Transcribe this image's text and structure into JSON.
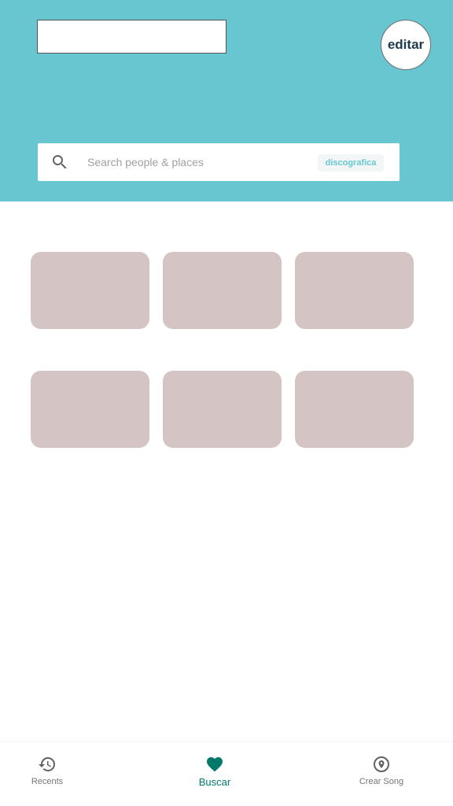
{
  "header": {
    "edit_label": "editar",
    "colors": {
      "background": "#67c6cf",
      "button_text": "#1f3a4a"
    }
  },
  "search": {
    "placeholder": "Search people & places",
    "value": "",
    "chip_label": "discografica"
  },
  "tiles": {
    "count": 6,
    "color": "#d4c4c4"
  },
  "bottom_nav": {
    "items": [
      {
        "label": "Recents",
        "icon": "history-icon",
        "active": false
      },
      {
        "label": "Buscar",
        "icon": "heart-icon",
        "active": true
      },
      {
        "label": "Crear Song",
        "icon": "location-pin-icon",
        "active": false
      }
    ],
    "active_color": "#00796b",
    "inactive_color": "#757575"
  }
}
